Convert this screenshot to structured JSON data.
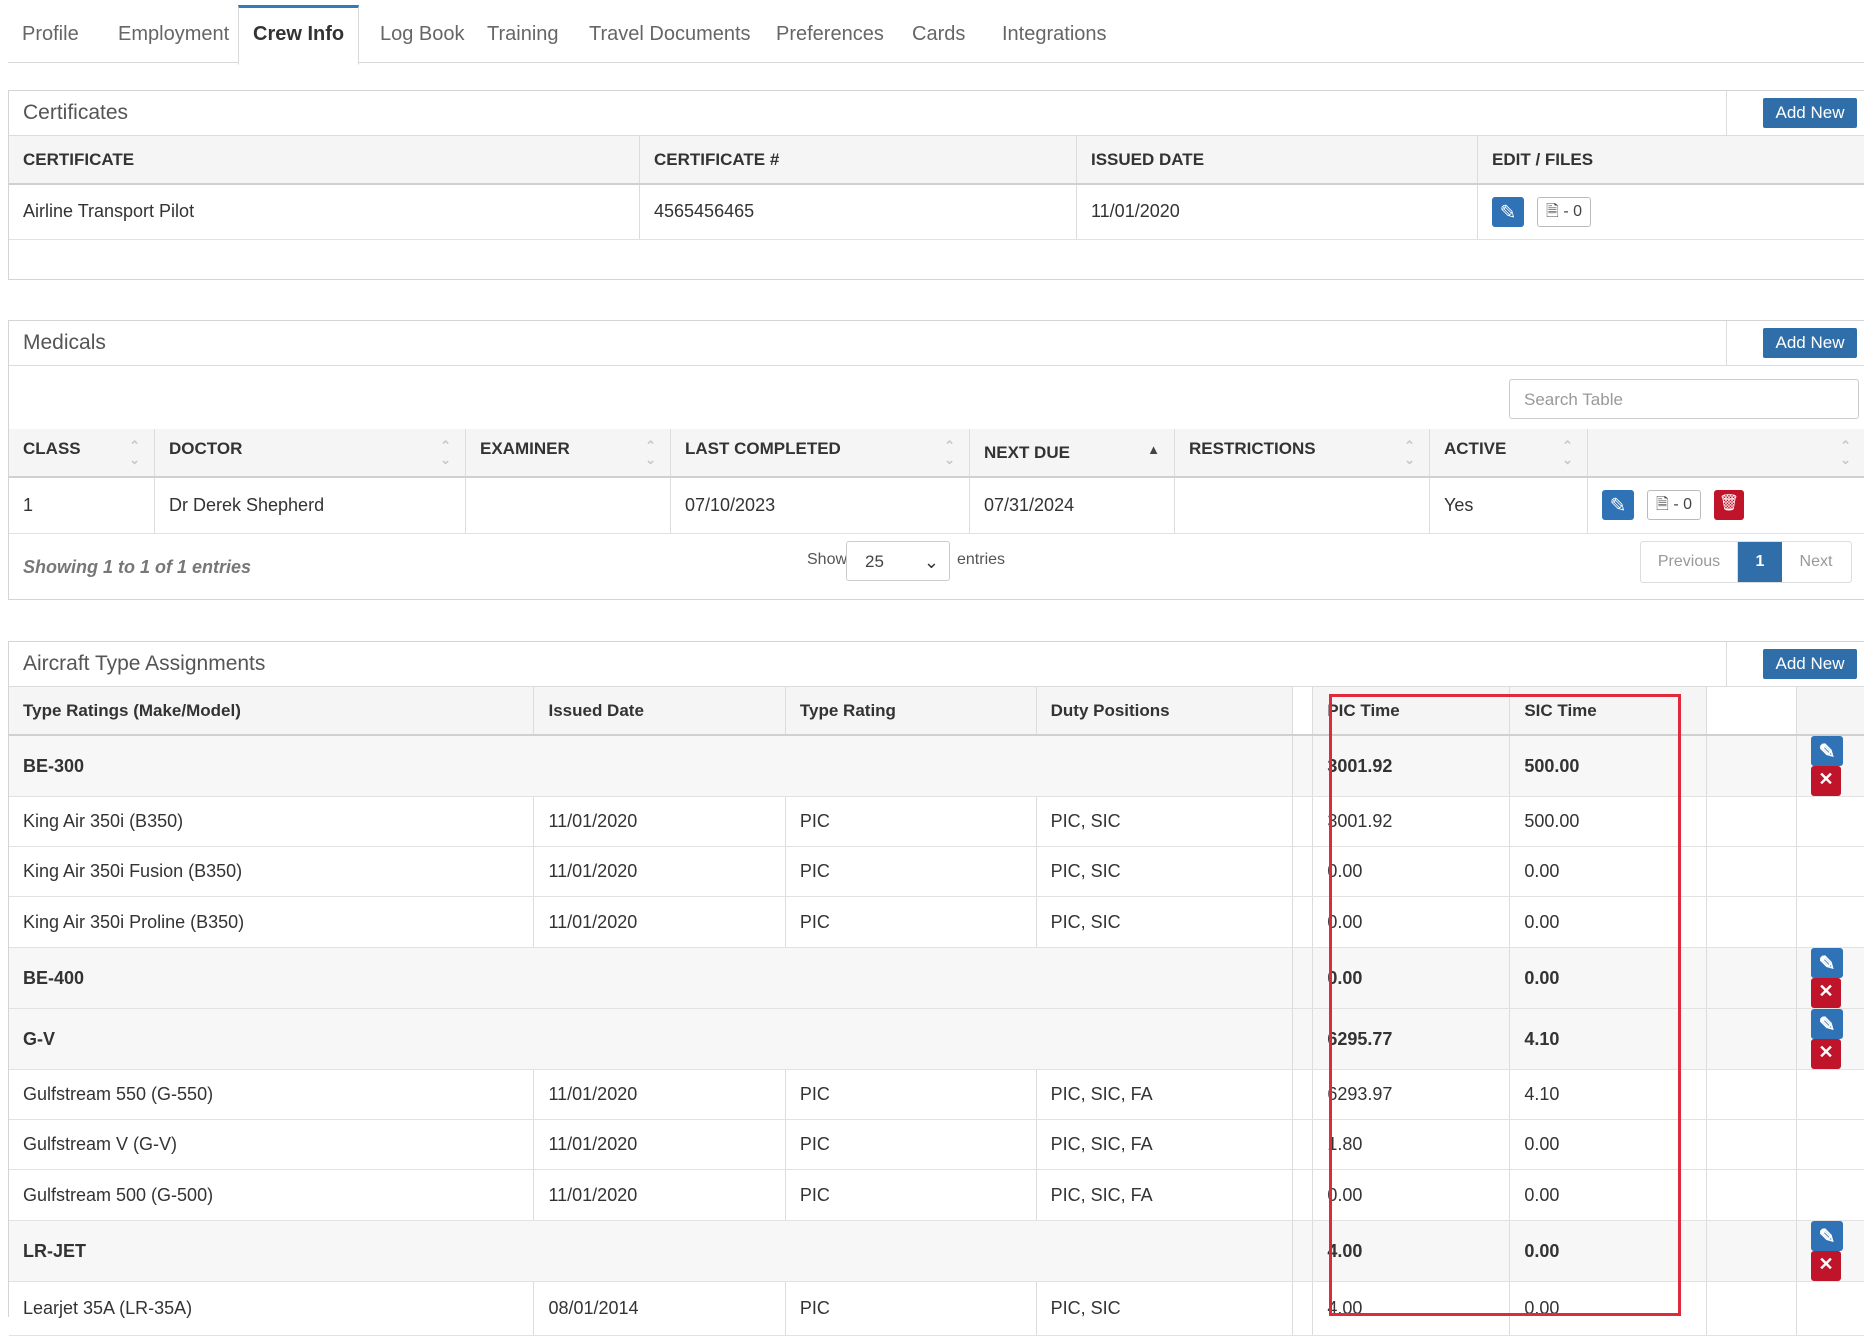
{
  "tabs": [
    "Profile",
    "Employment",
    "Crew Info",
    "Log Book",
    "Training",
    "Travel Documents",
    "Preferences",
    "Cards",
    "Integrations"
  ],
  "active_tab": "Crew Info",
  "certificates": {
    "title": "Certificates",
    "add_label": "Add New",
    "columns": [
      "CERTIFICATE",
      "CERTIFICATE #",
      "ISSUED DATE",
      "EDIT / FILES"
    ],
    "rows": [
      {
        "certificate": "Airline Transport Pilot",
        "number": "4565456465",
        "issued": "11/01/2020",
        "files": "- 0"
      }
    ]
  },
  "medicals": {
    "title": "Medicals",
    "add_label": "Add New",
    "search_placeholder": "Search Table",
    "columns": [
      "CLASS",
      "DOCTOR",
      "EXAMINER",
      "LAST COMPLETED",
      "NEXT DUE",
      "RESTRICTIONS",
      "ACTIVE"
    ],
    "rows": [
      {
        "class": "1",
        "doctor": "Dr Derek Shepherd",
        "examiner": "",
        "last_completed": "07/10/2023",
        "next_due": "07/31/2024",
        "restrictions": "",
        "active": "Yes",
        "files": "- 0"
      }
    ],
    "showing": "Showing 1 to 1 of 1 entries",
    "show_label": "Show",
    "entries_label": "entries",
    "page_size": "25",
    "prev_label": "Previous",
    "current_page": "1",
    "next_label": "Next"
  },
  "aircraft": {
    "title": "Aircraft Type Assignments",
    "add_label": "Add New",
    "columns": [
      "Type Ratings (Make/Model)",
      "Issued Date",
      "Type Rating",
      "Duty Positions",
      "PIC Time",
      "SIC Time"
    ],
    "rows": [
      {
        "group": true,
        "name": "BE-300",
        "pic": "3001.92",
        "sic": "500.00"
      },
      {
        "group": false,
        "name": "King Air 350i (B350)",
        "issued": "11/01/2020",
        "rating": "PIC",
        "duty": "PIC, SIC",
        "pic": "3001.92",
        "sic": "500.00"
      },
      {
        "group": false,
        "name": "King Air 350i Fusion (B350)",
        "issued": "11/01/2020",
        "rating": "PIC",
        "duty": "PIC, SIC",
        "pic": "0.00",
        "sic": "0.00"
      },
      {
        "group": false,
        "name": "King Air 350i Proline (B350)",
        "issued": "11/01/2020",
        "rating": "PIC",
        "duty": "PIC, SIC",
        "pic": "0.00",
        "sic": "0.00"
      },
      {
        "group": true,
        "name": "BE-400",
        "pic": "0.00",
        "sic": "0.00"
      },
      {
        "group": true,
        "name": "G-V",
        "pic": "6295.77",
        "sic": "4.10"
      },
      {
        "group": false,
        "name": "Gulfstream 550 (G-550)",
        "issued": "11/01/2020",
        "rating": "PIC",
        "duty": "PIC, SIC, FA",
        "pic": "6293.97",
        "sic": "4.10"
      },
      {
        "group": false,
        "name": "Gulfstream V (G-V)",
        "issued": "11/01/2020",
        "rating": "PIC",
        "duty": "PIC, SIC, FA",
        "pic": "1.80",
        "sic": "0.00"
      },
      {
        "group": false,
        "name": "Gulfstream 500 (G-500)",
        "issued": "11/01/2020",
        "rating": "PIC",
        "duty": "PIC, SIC, FA",
        "pic": "0.00",
        "sic": "0.00"
      },
      {
        "group": true,
        "name": "LR-JET",
        "pic": "4.00",
        "sic": "0.00"
      },
      {
        "group": false,
        "name": "Learjet 35A (LR-35A)",
        "issued": "08/01/2014",
        "rating": "PIC",
        "duty": "PIC, SIC",
        "pic": "4.00",
        "sic": "0.00"
      }
    ]
  },
  "colors": {
    "primary": "#2f6ea8",
    "danger": "#c0142b",
    "highlight": "#e0293a"
  }
}
